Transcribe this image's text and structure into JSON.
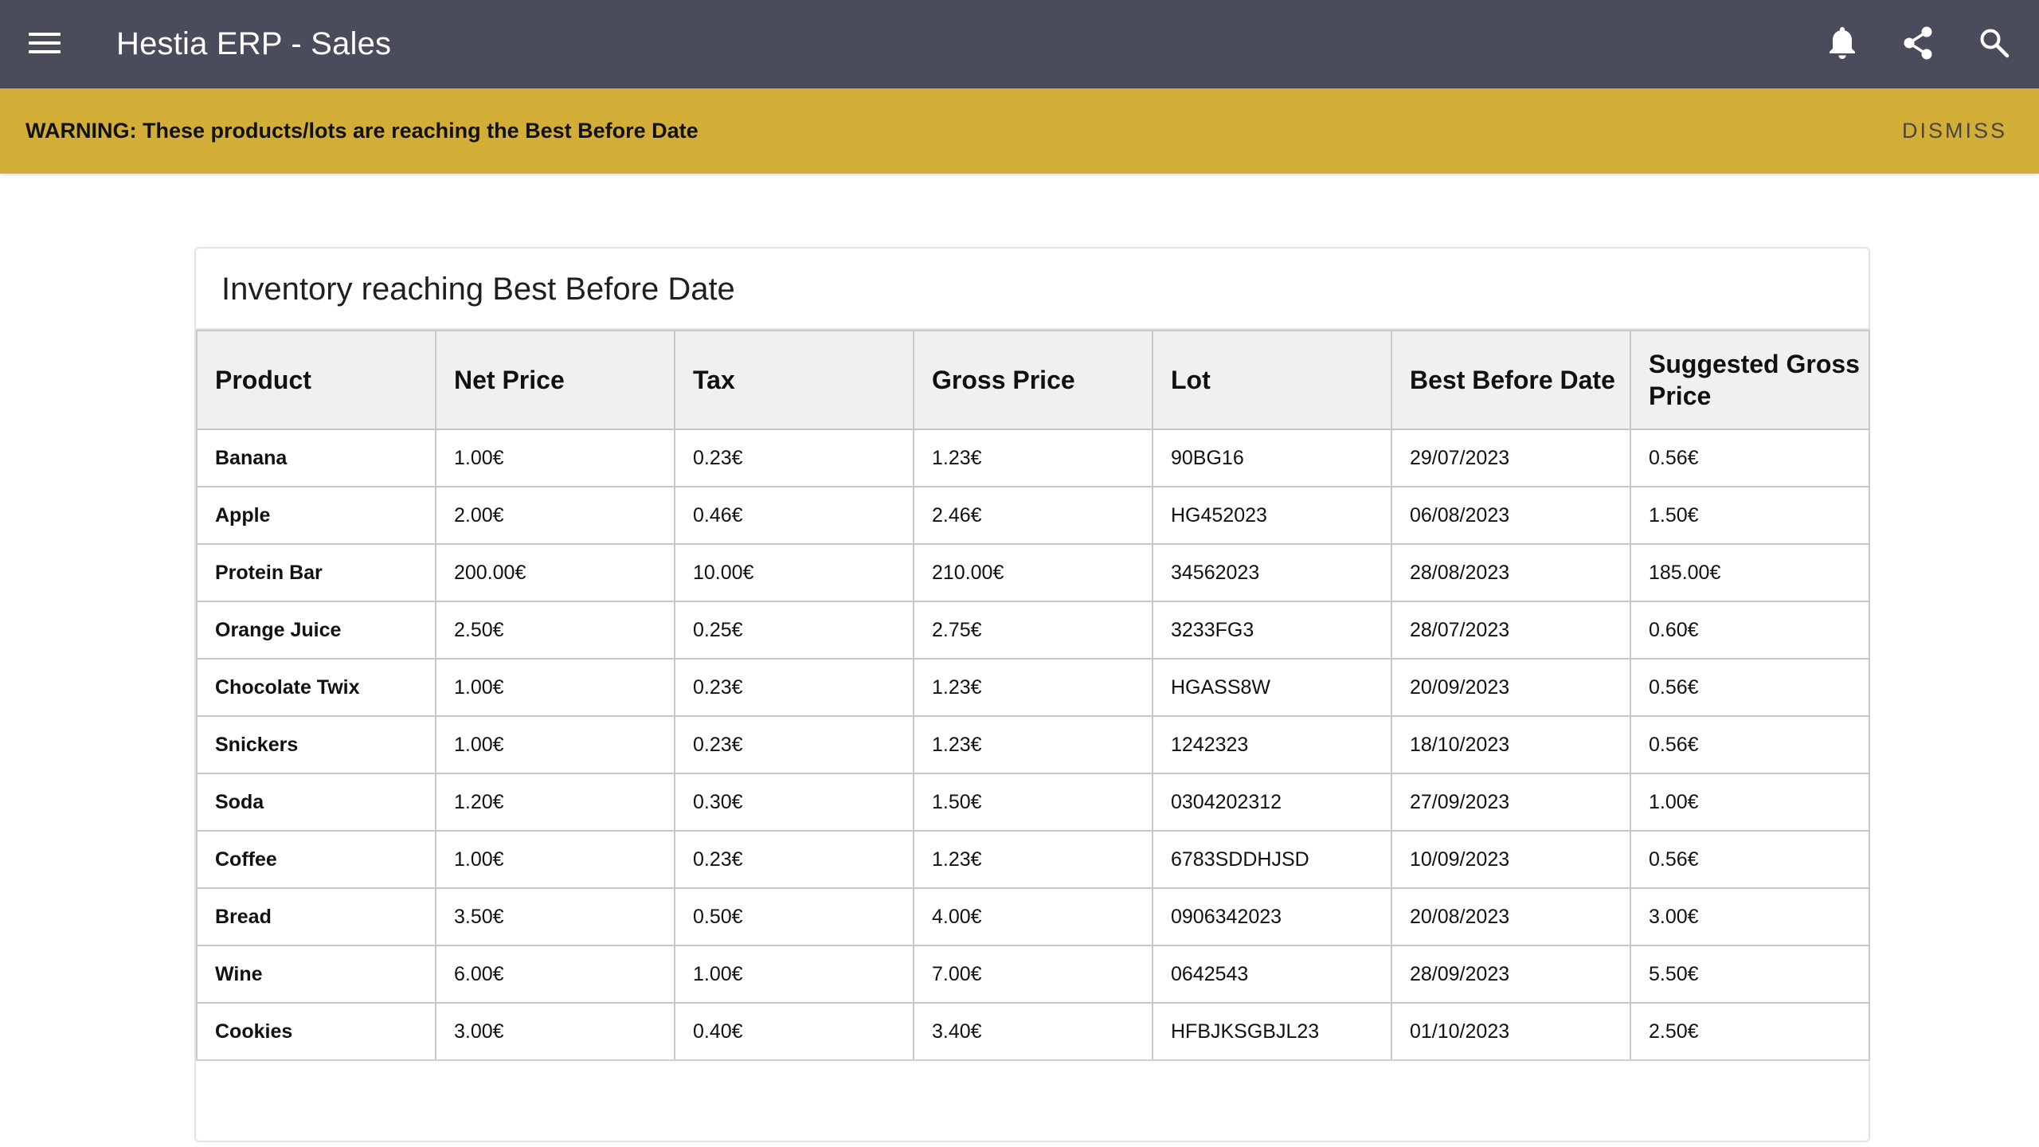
{
  "appbar": {
    "title": "Hestia ERP - Sales",
    "menu_icon": "menu-icon",
    "actions": [
      {
        "icon": "bell-icon"
      },
      {
        "icon": "share-icon"
      },
      {
        "icon": "search-icon"
      }
    ],
    "background": "#4a4c5b"
  },
  "banner": {
    "text": "WARNING: These products/lots are reaching the Best Before Date",
    "dismiss_label": "DISMISS",
    "background": "#d2ae37"
  },
  "card": {
    "title": "Inventory reaching Best Before Date"
  },
  "table": {
    "columns": [
      "Product",
      "Net Price",
      "Tax",
      "Gross Price",
      "Lot",
      "Best Before Date",
      "Suggested Gross Price"
    ],
    "rows": [
      [
        "Banana",
        "1.00€",
        "0.23€",
        "1.23€",
        "90BG16",
        "29/07/2023",
        "0.56€"
      ],
      [
        "Apple",
        "2.00€",
        "0.46€",
        "2.46€",
        "HG452023",
        "06/08/2023",
        "1.50€"
      ],
      [
        "Protein Bar",
        "200.00€",
        "10.00€",
        "210.00€",
        "34562023",
        "28/08/2023",
        "185.00€"
      ],
      [
        "Orange Juice",
        "2.50€",
        "0.25€",
        "2.75€",
        "3233FG3",
        "28/07/2023",
        "0.60€"
      ],
      [
        "Chocolate Twix",
        "1.00€",
        "0.23€",
        "1.23€",
        "HGASS8W",
        "20/09/2023",
        "0.56€"
      ],
      [
        "Snickers",
        "1.00€",
        "0.23€",
        "1.23€",
        "1242323",
        "18/10/2023",
        "0.56€"
      ],
      [
        "Soda",
        "1.20€",
        "0.30€",
        "1.50€",
        "0304202312",
        "27/09/2023",
        "1.00€"
      ],
      [
        "Coffee",
        "1.00€",
        "0.23€",
        "1.23€",
        "6783SDDHJSD",
        "10/09/2023",
        "0.56€"
      ],
      [
        "Bread",
        "3.50€",
        "0.50€",
        "4.00€",
        "0906342023",
        "20/08/2023",
        "3.00€"
      ],
      [
        "Wine",
        "6.00€",
        "1.00€",
        "7.00€",
        "0642543",
        "28/09/2023",
        "5.50€"
      ],
      [
        "Cookies",
        "3.00€",
        "0.40€",
        "3.40€",
        "HFBJKSGBJL23",
        "01/10/2023",
        "2.50€"
      ]
    ]
  }
}
